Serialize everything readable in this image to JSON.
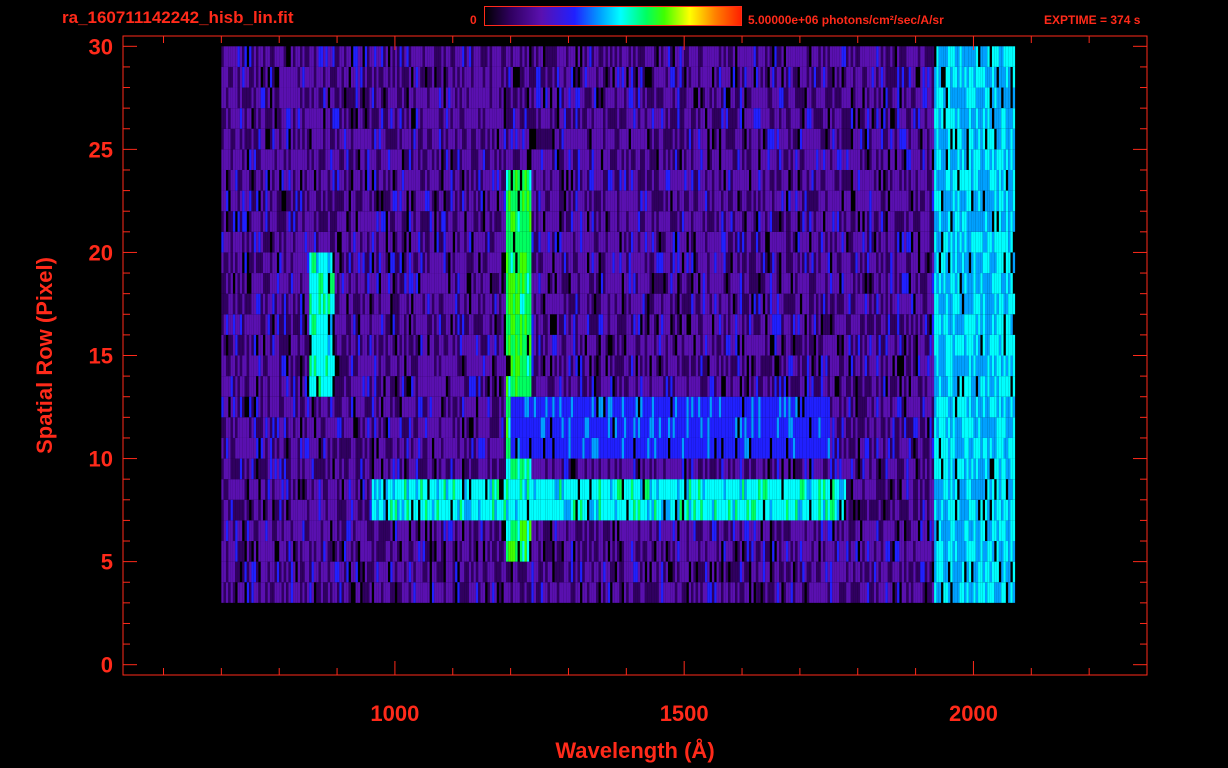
{
  "header": {
    "file_title": "ra_160711142242_hisb_lin.fit",
    "colorbar_min_label": "0",
    "colorbar_max_label": "5.00000e+06 photons/cm²/sec/A/sr",
    "exptime_label": "EXPTIME = 374 s"
  },
  "colors": {
    "axis": "#ff2a1a",
    "background": "#000000",
    "colormap": [
      "#000000",
      "#300060",
      "#5a10b0",
      "#2020ff",
      "#00a0ff",
      "#00ffff",
      "#00ff60",
      "#40ff00",
      "#ffff00",
      "#ff8000",
      "#ff2000"
    ]
  },
  "chart_data": {
    "type": "heatmap",
    "title": "ra_160711142242_hisb_lin.fit",
    "xlabel": "Wavelength (Å)",
    "ylabel": "Spatial Row (Pixel)",
    "xlim": [
      530,
      2300
    ],
    "ylim": [
      -0.5,
      30.5
    ],
    "x_ticks": [
      1000,
      1500,
      2000
    ],
    "y_ticks": [
      0,
      5,
      10,
      15,
      20,
      25,
      30
    ],
    "x_tick_labels": [
      "1000",
      "1500",
      "2000"
    ],
    "y_tick_labels": [
      "0",
      "5",
      "10",
      "15",
      "20",
      "25",
      "30"
    ],
    "colorbar": {
      "min": 0,
      "max": 5000000,
      "unit": "photons/cm²/sec/A/sr"
    },
    "exposure_time_s": 374,
    "background_region": {
      "x_range": [
        700,
        2070
      ],
      "y_range": [
        3,
        30
      ],
      "level": 0.18
    },
    "features": [
      {
        "x_range": [
          1190,
          1235
        ],
        "y_range": [
          5,
          24
        ],
        "level": 0.62
      },
      {
        "x_range": [
          850,
          895
        ],
        "y_range": [
          13,
          20
        ],
        "level": 0.52
      },
      {
        "x_range": [
          960,
          1780
        ],
        "y_range": [
          7,
          9
        ],
        "level": 0.5
      },
      {
        "x_range": [
          1200,
          1750
        ],
        "y_range": [
          10,
          13
        ],
        "level": 0.32
      },
      {
        "x_range": [
          1930,
          2070
        ],
        "y_range": [
          3,
          30
        ],
        "level": 0.45
      }
    ]
  }
}
